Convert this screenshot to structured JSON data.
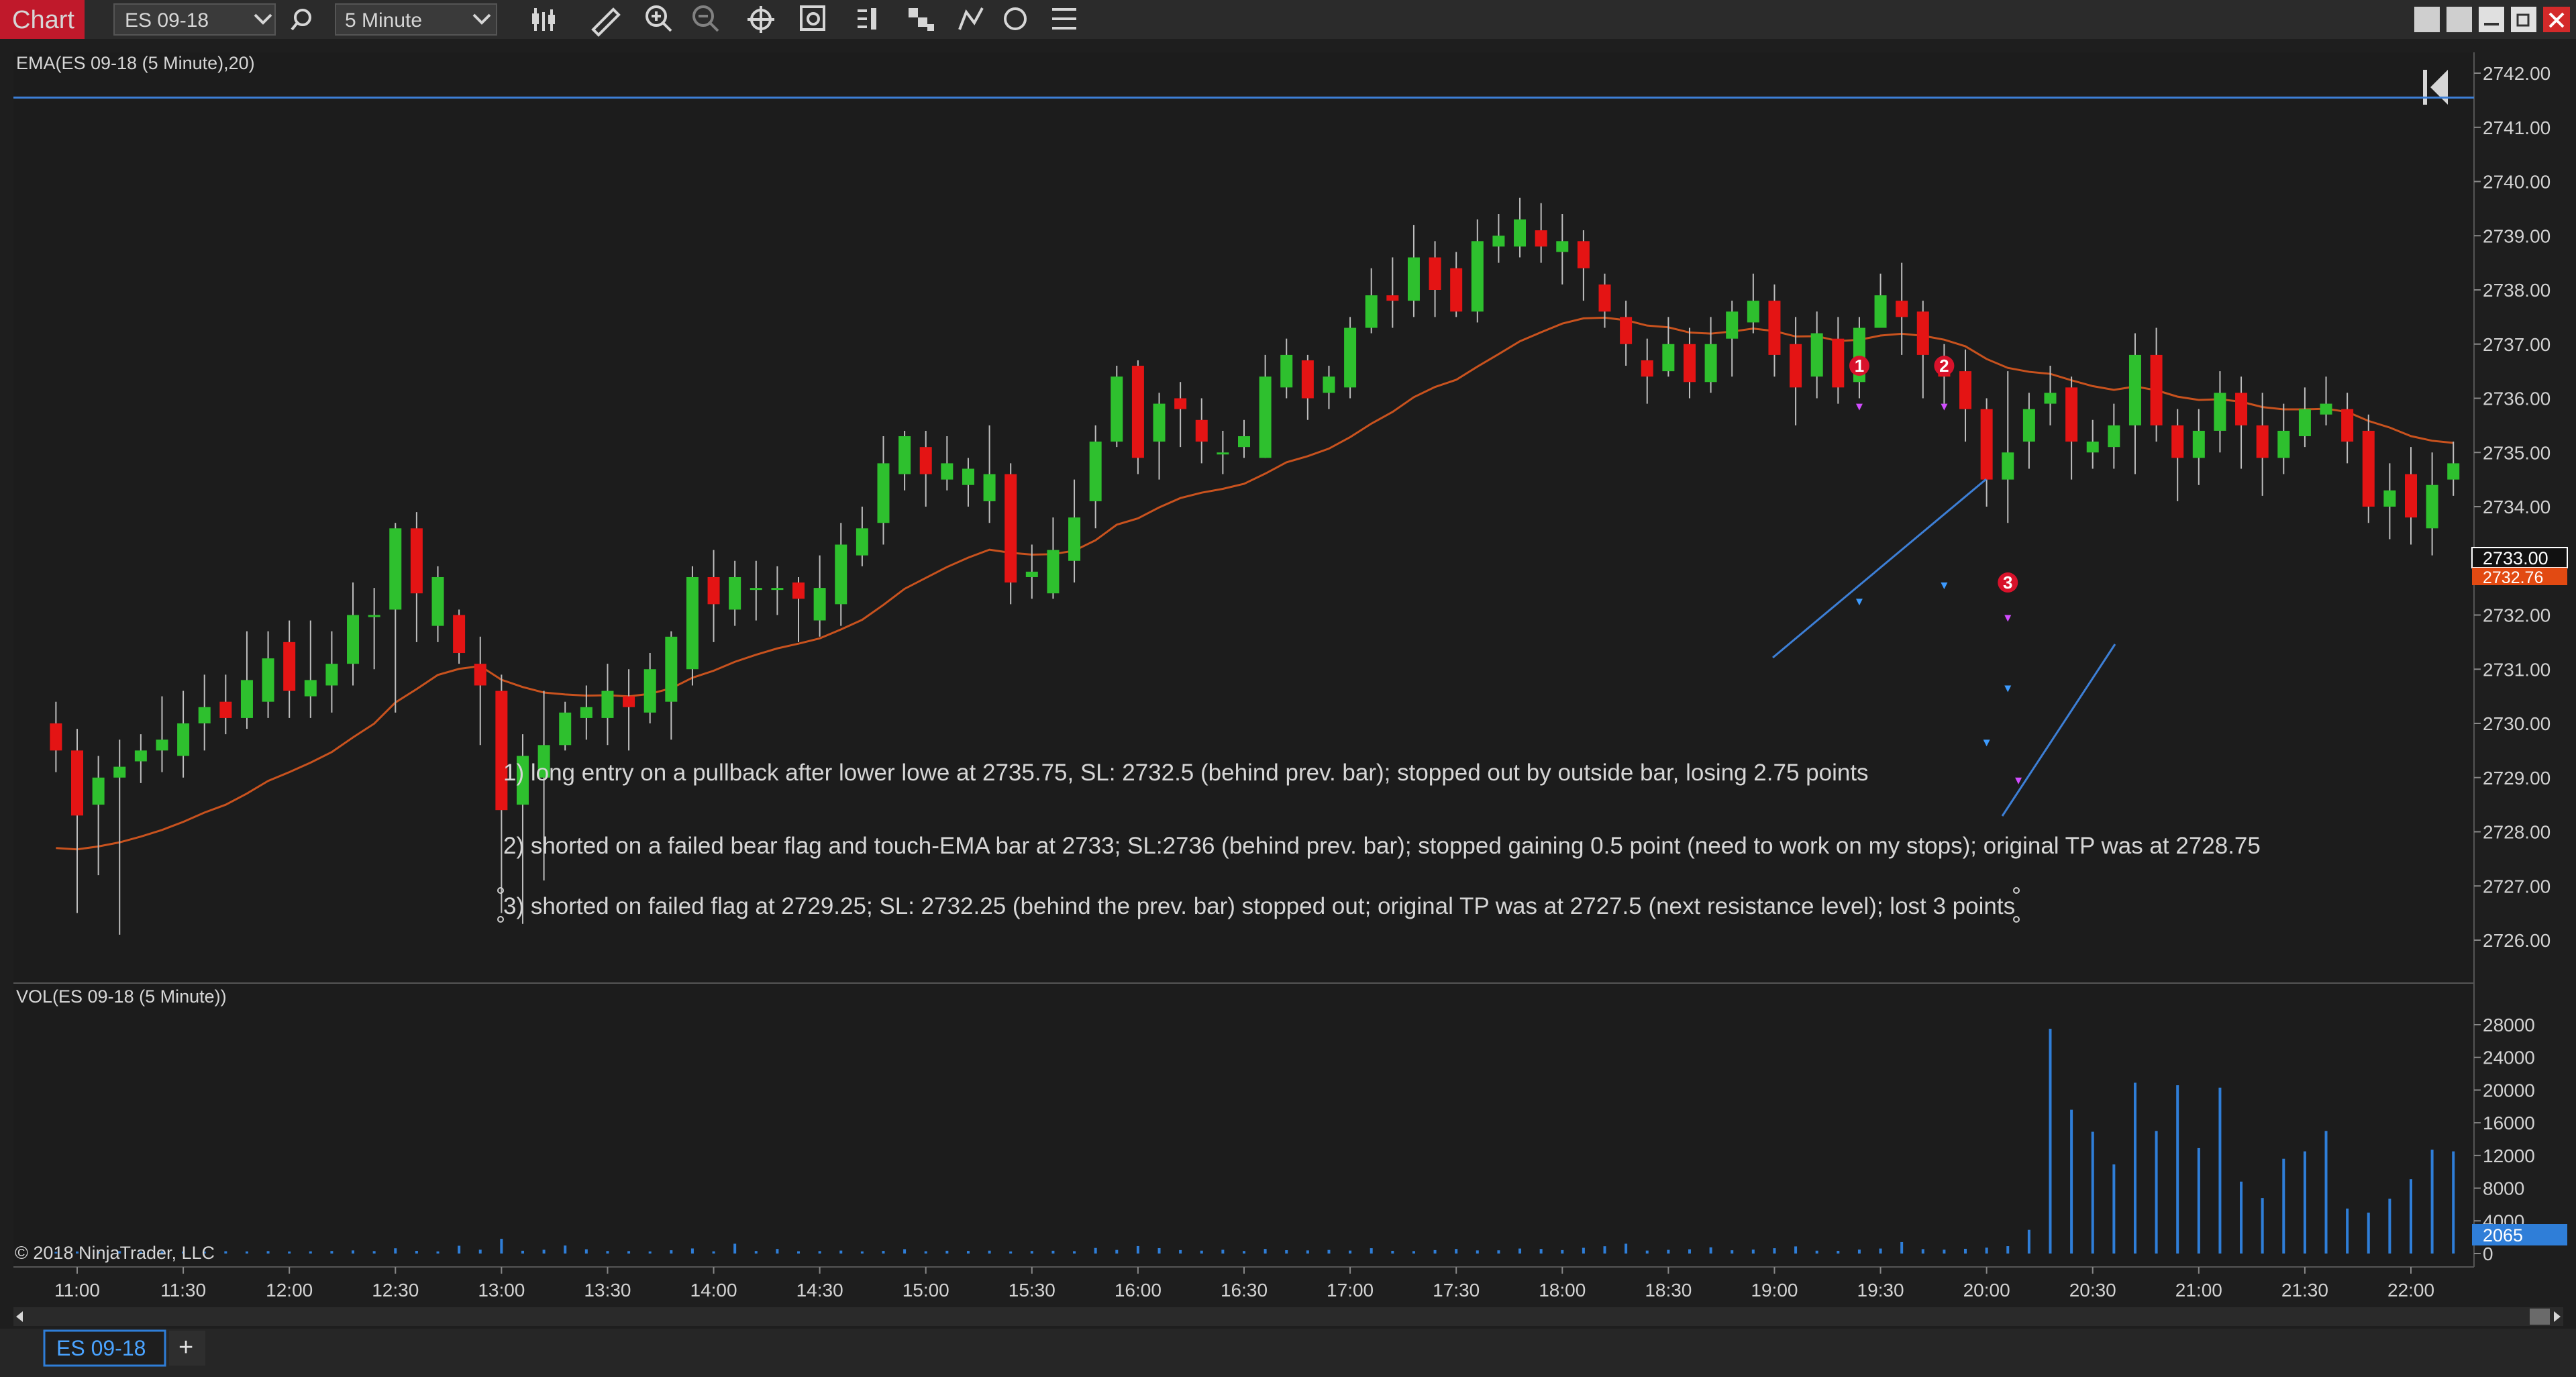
{
  "window": {
    "title": "Chart",
    "instrument": "ES 09-18",
    "interval": "5 Minute"
  },
  "toolbar": {
    "icons": [
      "search-icon",
      "bar-type-icon",
      "drawing-tool-icon",
      "zoom-in-icon",
      "zoom-out-icon",
      "crosshair-icon",
      "properties-icon",
      "indicators-icon",
      "strategies-icon",
      "drawing-objects-icon",
      "refresh-icon",
      "menu-icon"
    ]
  },
  "window_controls": [
    "tile-icon",
    "tile-icon-2",
    "minimize-icon",
    "restore-icon",
    "close-icon"
  ],
  "colors": {
    "background": "#1e1e1e",
    "up_bar": "#2ec02e",
    "down_bar": "#e41414",
    "ema": "#c8521e",
    "volume": "#2f7ed8",
    "trend_line": "#3d7fd6",
    "title_bg": "#c0192b",
    "price_marker_bg": "#e24a12",
    "volume_marker_bg": "#2f7ed8"
  },
  "chart_data": [
    {
      "type": "candlestick",
      "label": "EMA(ES 09-18 (5 Minute),20)",
      "ylim": [
        2725.6,
        2742.2
      ],
      "y_ticks": [
        "2742.00",
        "2741.00",
        "2740.00",
        "2739.00",
        "2738.00",
        "2737.00",
        "2736.00",
        "2735.00",
        "2734.00",
        "2733.00",
        "2732.00",
        "2731.00",
        "2730.00",
        "2729.00",
        "2728.00",
        "2727.00",
        "2726.00"
      ],
      "x_ticks": [
        "11:00",
        "11:30",
        "12:00",
        "12:30",
        "13:00",
        "13:30",
        "14:00",
        "14:30",
        "15:00",
        "15:30",
        "16:00",
        "16:30",
        "17:00",
        "17:30",
        "18:00",
        "18:30",
        "19:00",
        "19:30",
        "20:00",
        "20:30",
        "21:00",
        "21:30",
        "22:00"
      ],
      "last_price": "2733.00",
      "ema_value": "2732.76",
      "horizontal_line": 2741.55,
      "candles": [
        [
          10.9,
          2730.0,
          2729.5,
          2730.4,
          2729.1
        ],
        [
          11.0,
          2729.5,
          2728.3,
          2729.9,
          2726.5
        ],
        [
          11.1,
          2728.5,
          2729.0,
          2729.4,
          2727.2
        ],
        [
          11.2,
          2729.0,
          2729.2,
          2729.7,
          2726.1
        ],
        [
          11.3,
          2729.3,
          2729.5,
          2729.8,
          2728.9
        ],
        [
          11.4,
          2729.5,
          2729.7,
          2730.5,
          2729.1
        ],
        [
          11.5,
          2729.4,
          2730.0,
          2730.6,
          2729.0
        ],
        [
          11.6,
          2730.0,
          2730.3,
          2730.9,
          2729.5
        ],
        [
          11.7,
          2730.4,
          2730.1,
          2730.9,
          2729.8
        ],
        [
          11.8,
          2730.1,
          2730.8,
          2731.7,
          2729.9
        ],
        [
          11.9,
          2730.4,
          2731.2,
          2731.7,
          2730.1
        ],
        [
          12.0,
          2731.5,
          2730.6,
          2731.9,
          2730.1
        ],
        [
          12.1,
          2730.5,
          2730.8,
          2731.9,
          2730.1
        ],
        [
          12.2,
          2730.7,
          2731.1,
          2731.7,
          2730.2
        ],
        [
          12.3,
          2731.1,
          2732.0,
          2732.6,
          2730.7
        ],
        [
          12.4,
          2732.0,
          2732.0,
          2732.5,
          2731.0
        ],
        [
          12.5,
          2732.1,
          2733.6,
          2733.7,
          2730.2
        ],
        [
          12.6,
          2733.6,
          2732.4,
          2733.9,
          2731.5
        ],
        [
          12.7,
          2731.8,
          2732.7,
          2732.9,
          2731.5
        ],
        [
          12.8,
          2732.0,
          2731.3,
          2732.1,
          2731.1
        ],
        [
          12.9,
          2731.1,
          2730.7,
          2731.6,
          2729.6
        ],
        [
          13.0,
          2730.6,
          2728.4,
          2730.9,
          2726.5
        ],
        [
          13.1,
          2728.5,
          2729.4,
          2729.8,
          2726.3
        ],
        [
          13.2,
          2729.0,
          2729.6,
          2730.6,
          2727.1
        ],
        [
          13.3,
          2729.6,
          2730.2,
          2730.4,
          2729.5
        ],
        [
          13.4,
          2730.1,
          2730.3,
          2730.7,
          2729.7
        ],
        [
          13.5,
          2730.1,
          2730.6,
          2731.1,
          2729.6
        ],
        [
          13.6,
          2730.5,
          2730.3,
          2731.0,
          2729.5
        ],
        [
          13.7,
          2730.2,
          2731.0,
          2731.3,
          2730.0
        ],
        [
          13.8,
          2730.4,
          2731.6,
          2731.7,
          2729.7
        ],
        [
          13.9,
          2731.0,
          2732.7,
          2732.9,
          2730.7
        ],
        [
          14.0,
          2732.7,
          2732.2,
          2733.2,
          2731.5
        ],
        [
          14.1,
          2732.1,
          2732.7,
          2733.0,
          2731.8
        ],
        [
          14.2,
          2732.5,
          2732.5,
          2733.0,
          2731.9
        ],
        [
          14.3,
          2732.5,
          2732.5,
          2732.9,
          2732.0
        ],
        [
          14.4,
          2732.6,
          2732.3,
          2732.7,
          2731.5
        ],
        [
          14.5,
          2731.9,
          2732.5,
          2733.1,
          2731.6
        ],
        [
          14.6,
          2732.2,
          2733.3,
          2733.7,
          2731.8
        ],
        [
          14.7,
          2733.1,
          2733.6,
          2734.0,
          2732.9
        ],
        [
          14.8,
          2733.7,
          2734.8,
          2735.3,
          2733.3
        ],
        [
          14.9,
          2734.6,
          2735.3,
          2735.4,
          2734.3
        ],
        [
          15.0,
          2735.1,
          2734.6,
          2735.4,
          2734.0
        ],
        [
          15.1,
          2734.5,
          2734.8,
          2735.3,
          2734.3
        ],
        [
          15.2,
          2734.4,
          2734.7,
          2734.9,
          2734.0
        ],
        [
          15.3,
          2734.1,
          2734.6,
          2735.5,
          2733.7
        ],
        [
          15.4,
          2734.6,
          2732.6,
          2734.8,
          2732.2
        ],
        [
          15.5,
          2732.7,
          2732.8,
          2733.3,
          2732.3
        ],
        [
          15.6,
          2732.4,
          2733.2,
          2733.8,
          2732.3
        ],
        [
          15.7,
          2733.0,
          2733.8,
          2734.5,
          2732.6
        ],
        [
          15.8,
          2734.1,
          2735.2,
          2735.5,
          2733.6
        ],
        [
          15.9,
          2735.2,
          2736.4,
          2736.6,
          2735.1
        ],
        [
          16.0,
          2736.6,
          2734.9,
          2736.7,
          2734.6
        ],
        [
          16.1,
          2735.2,
          2735.9,
          2736.1,
          2734.5
        ],
        [
          16.2,
          2736.0,
          2735.8,
          2736.3,
          2735.1
        ],
        [
          16.3,
          2735.6,
          2735.2,
          2736.0,
          2734.8
        ],
        [
          16.4,
          2735.0,
          2735.0,
          2735.4,
          2734.6
        ],
        [
          16.5,
          2735.1,
          2735.3,
          2735.6,
          2734.9
        ],
        [
          16.6,
          2734.9,
          2736.4,
          2736.8,
          2734.9
        ],
        [
          16.7,
          2736.2,
          2736.8,
          2737.1,
          2736.0
        ],
        [
          16.8,
          2736.7,
          2736.0,
          2736.8,
          2735.6
        ],
        [
          16.9,
          2736.1,
          2736.4,
          2736.6,
          2735.8
        ],
        [
          17.0,
          2736.2,
          2737.3,
          2737.5,
          2736.0
        ],
        [
          17.1,
          2737.3,
          2737.9,
          2738.4,
          2737.2
        ],
        [
          17.2,
          2737.9,
          2737.8,
          2738.6,
          2737.3
        ],
        [
          17.3,
          2737.8,
          2738.6,
          2739.2,
          2737.5
        ],
        [
          17.4,
          2738.6,
          2738.0,
          2738.9,
          2737.5
        ],
        [
          17.5,
          2738.4,
          2737.6,
          2738.7,
          2737.5
        ],
        [
          17.6,
          2737.6,
          2738.9,
          2739.3,
          2737.4
        ],
        [
          17.7,
          2738.8,
          2739.0,
          2739.4,
          2738.5
        ],
        [
          17.8,
          2738.8,
          2739.3,
          2739.7,
          2738.6
        ],
        [
          17.9,
          2739.1,
          2738.8,
          2739.6,
          2738.5
        ],
        [
          18.0,
          2738.7,
          2738.9,
          2739.4,
          2738.1
        ],
        [
          18.1,
          2738.9,
          2738.4,
          2739.1,
          2737.8
        ],
        [
          18.2,
          2738.1,
          2737.6,
          2738.3,
          2737.3
        ],
        [
          18.3,
          2737.5,
          2737.0,
          2737.8,
          2736.6
        ],
        [
          18.4,
          2736.7,
          2736.4,
          2737.1,
          2735.9
        ],
        [
          18.5,
          2736.5,
          2737.0,
          2737.5,
          2736.4
        ],
        [
          18.6,
          2737.0,
          2736.3,
          2737.3,
          2736.0
        ],
        [
          18.7,
          2736.3,
          2737.0,
          2737.5,
          2736.1
        ],
        [
          18.8,
          2737.1,
          2737.6,
          2737.8,
          2736.4
        ],
        [
          18.9,
          2737.4,
          2737.8,
          2738.3,
          2737.2
        ],
        [
          19.0,
          2737.8,
          2736.8,
          2738.1,
          2736.4
        ],
        [
          19.1,
          2737.0,
          2736.2,
          2737.5,
          2735.5
        ],
        [
          19.2,
          2736.4,
          2737.2,
          2737.6,
          2736.0
        ],
        [
          19.3,
          2737.1,
          2736.2,
          2737.5,
          2735.9
        ],
        [
          19.4,
          2736.3,
          2737.3,
          2737.5,
          2736.0
        ],
        [
          19.5,
          2737.3,
          2737.9,
          2738.3,
          2737.3
        ],
        [
          19.6,
          2737.8,
          2737.5,
          2738.5,
          2736.8
        ],
        [
          19.7,
          2737.6,
          2736.8,
          2737.8,
          2736.0
        ],
        [
          19.8,
          2736.7,
          2736.4,
          2737.0,
          2735.9
        ],
        [
          19.9,
          2736.5,
          2735.8,
          2736.9,
          2735.2
        ],
        [
          20.0,
          2735.8,
          2734.5,
          2736.0,
          2734.0
        ],
        [
          20.1,
          2734.5,
          2735.0,
          2736.5,
          2733.7
        ],
        [
          20.2,
          2735.2,
          2735.8,
          2736.1,
          2734.7
        ],
        [
          20.3,
          2735.9,
          2736.1,
          2736.6,
          2735.5
        ],
        [
          20.4,
          2736.2,
          2735.2,
          2736.4,
          2734.5
        ],
        [
          20.5,
          2735.0,
          2735.2,
          2735.6,
          2734.7
        ],
        [
          20.6,
          2735.1,
          2735.5,
          2735.9,
          2734.7
        ],
        [
          20.7,
          2735.5,
          2736.8,
          2737.2,
          2734.6
        ],
        [
          20.8,
          2736.8,
          2735.5,
          2737.3,
          2735.2
        ],
        [
          20.9,
          2735.5,
          2734.9,
          2735.8,
          2734.1
        ],
        [
          21.0,
          2734.9,
          2735.4,
          2735.8,
          2734.4
        ],
        [
          21.1,
          2735.4,
          2736.1,
          2736.5,
          2735.0
        ],
        [
          21.2,
          2736.1,
          2735.5,
          2736.4,
          2734.7
        ],
        [
          21.3,
          2735.5,
          2734.9,
          2736.1,
          2734.2
        ],
        [
          21.4,
          2734.9,
          2735.4,
          2735.9,
          2734.6
        ],
        [
          21.5,
          2735.3,
          2735.8,
          2736.2,
          2735.1
        ],
        [
          21.6,
          2735.7,
          2735.9,
          2736.4,
          2735.5
        ],
        [
          21.7,
          2735.8,
          2735.2,
          2736.1,
          2734.8
        ],
        [
          21.8,
          2735.4,
          2734.0,
          2735.7,
          2733.7
        ],
        [
          21.9,
          2734.0,
          2734.3,
          2734.8,
          2733.4
        ],
        [
          22.0,
          2734.6,
          2733.8,
          2735.1,
          2733.3
        ],
        [
          22.1,
          2733.6,
          2734.4,
          2735.0,
          2733.1
        ],
        [
          22.2,
          2734.5,
          2734.8,
          2735.2,
          2734.2
        ]
      ],
      "annotations": [
        {
          "label": "1",
          "x": 19.4,
          "y": 2736.6
        },
        {
          "label": "2",
          "x": 19.8,
          "y": 2736.6
        },
        {
          "label": "3",
          "x": 20.1,
          "y": 2732.6
        }
      ]
    },
    {
      "type": "bar",
      "label": "VOL(ES 09-18 (5 Minute))",
      "ylim": [
        0,
        28000
      ],
      "y_ticks": [
        "28000",
        "24000",
        "20000",
        "16000",
        "12000",
        "8000",
        "4000",
        "0"
      ],
      "last_volume": "2065",
      "values": [
        200,
        250,
        220,
        300,
        210,
        260,
        240,
        230,
        280,
        260,
        300,
        250,
        270,
        310,
        380,
        300,
        640,
        330,
        260,
        950,
        470,
        1800,
        340,
        460,
        980,
        520,
        310,
        300,
        260,
        400,
        620,
        270,
        1200,
        310,
        560,
        280,
        300,
        360,
        260,
        320,
        530,
        280,
        340,
        320,
        350,
        260,
        310,
        340,
        290,
        680,
        440,
        910,
        660,
        420,
        350,
        460,
        310,
        560,
        410,
        380,
        440,
        360,
        650,
        330,
        300,
        420,
        560,
        380,
        390,
        610,
        560,
        420,
        700,
        890,
        1200,
        360,
        450,
        520,
        760,
        400,
        480,
        650,
        870,
        350,
        330,
        480,
        610,
        1400,
        540,
        470,
        580,
        720,
        900,
        2900,
        27500,
        17600,
        14900,
        10900,
        20900,
        15000,
        20600,
        12900,
        20300,
        8800,
        6800,
        11600,
        12500,
        15000,
        5500,
        5000,
        6700,
        9100,
        12700,
        12500,
        6400,
        9800,
        8000,
        5500,
        4800,
        7600,
        2100
      ]
    }
  ],
  "annotation_text": {
    "note1": "1)  long entry on a pullback after lower lowe at 2735.75, SL: 2732.5 (behind prev. bar); stopped out by outside bar, losing 2.75 points",
    "note2": "2) shorted on a failed bear flag and touch-EMA bar at 2733; SL:2736 (behind prev. bar); stopped gaining 0.5 point (need to work on my stops); original TP was at 2728.75",
    "note3": "3) shorted on failed flag at 2729.25; SL: 2732.25 (behind the prev. bar) stopped out; original TP was at 2727.5 (next resistance level); lost 3 points"
  },
  "copyright": "© 2018 NinjaTrader, LLC",
  "bottom_tabs": [
    {
      "label": "ES 09-18",
      "active": true
    },
    {
      "label": "+",
      "active": false
    }
  ]
}
